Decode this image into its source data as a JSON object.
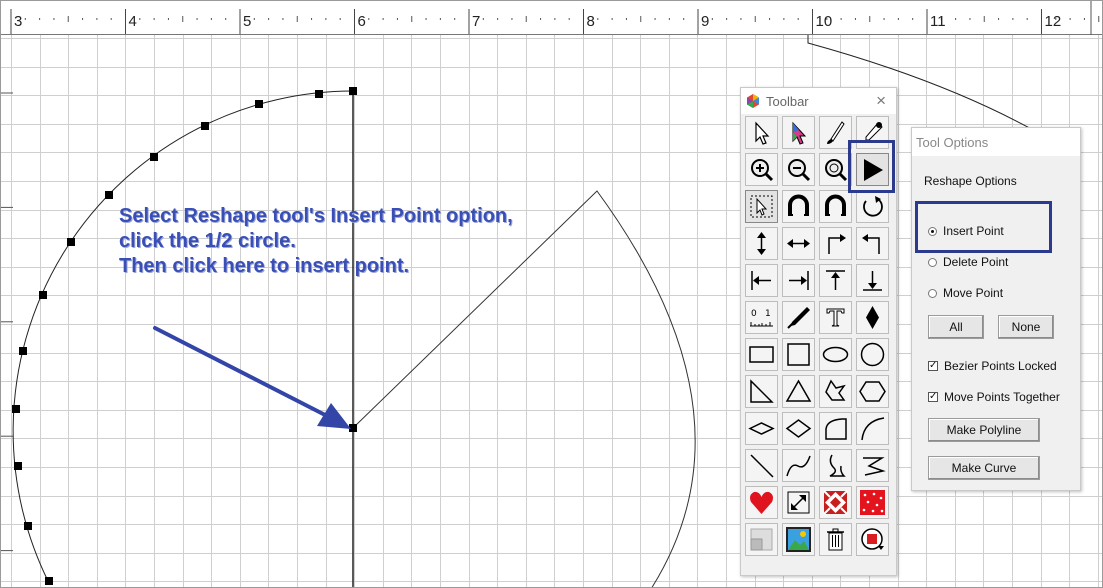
{
  "ruler": {
    "numbers": [
      "3",
      "4",
      "5",
      "6",
      "7",
      "8",
      "9",
      "10",
      "11",
      "12"
    ]
  },
  "callout": {
    "line1": "Select Reshape tool's Insert Point option,",
    "line2": "click the 1/2 circle.",
    "line3": "Then click here to insert point."
  },
  "toolbar": {
    "title": "Toolbar",
    "close": "×",
    "tools": [
      "select-arrow-icon",
      "color-select-arrow-icon",
      "brush-icon",
      "eyedropper-icon",
      "zoom-in-icon",
      "zoom-out-icon",
      "zoom-fit-icon",
      "reshape-arrow-icon",
      "select-box-icon",
      "arc-magnet-icon",
      "arc-reverse-icon",
      "rotate-icon",
      "vertical-arrows-icon",
      "horizontal-arrows-icon",
      "corner-arrow-right-icon",
      "corner-arrow-left-icon",
      "align-left-icon",
      "align-right-icon",
      "align-top-icon",
      "align-bottom-icon",
      "ruler-icon",
      "knife-icon",
      "text-tool-icon",
      "diamond-fill-icon",
      "rectangle-icon",
      "square-icon",
      "ellipse-icon",
      "circle-icon",
      "right-triangle-icon",
      "triangle-icon",
      "irregular-shape-icon",
      "hexagon-icon",
      "wide-diamond-icon",
      "diamond-outline-icon",
      "quarter-circle-icon",
      "curve-icon",
      "line-icon",
      "s-curve-icon",
      "freehand-icon",
      "zigzag-icon",
      "heart-icon",
      "resize-icon",
      "quilt-block-icon",
      "red-fabric-icon",
      "layout-icon",
      "photo-icon",
      "trash-icon",
      "fabric-swap-icon"
    ],
    "selected_tool": "reshape-arrow-icon"
  },
  "tool_options": {
    "title": "Tool Options",
    "section": "Reshape Options",
    "radios": [
      {
        "label": "Insert Point",
        "checked": true
      },
      {
        "label": "Delete Point",
        "checked": false
      },
      {
        "label": "Move Point",
        "checked": false
      }
    ],
    "all_label": "All",
    "none_label": "None",
    "checkboxes": [
      {
        "label": "Bezier Points Locked",
        "checked": true
      },
      {
        "label": "Move Points Together",
        "checked": true
      }
    ],
    "make_polyline_label": "Make Polyline",
    "make_curve_label": "Make Curve"
  },
  "colors": {
    "callout": "#3a4fb5",
    "highlight": "#2b3a8c",
    "heart": "#e0141e"
  }
}
